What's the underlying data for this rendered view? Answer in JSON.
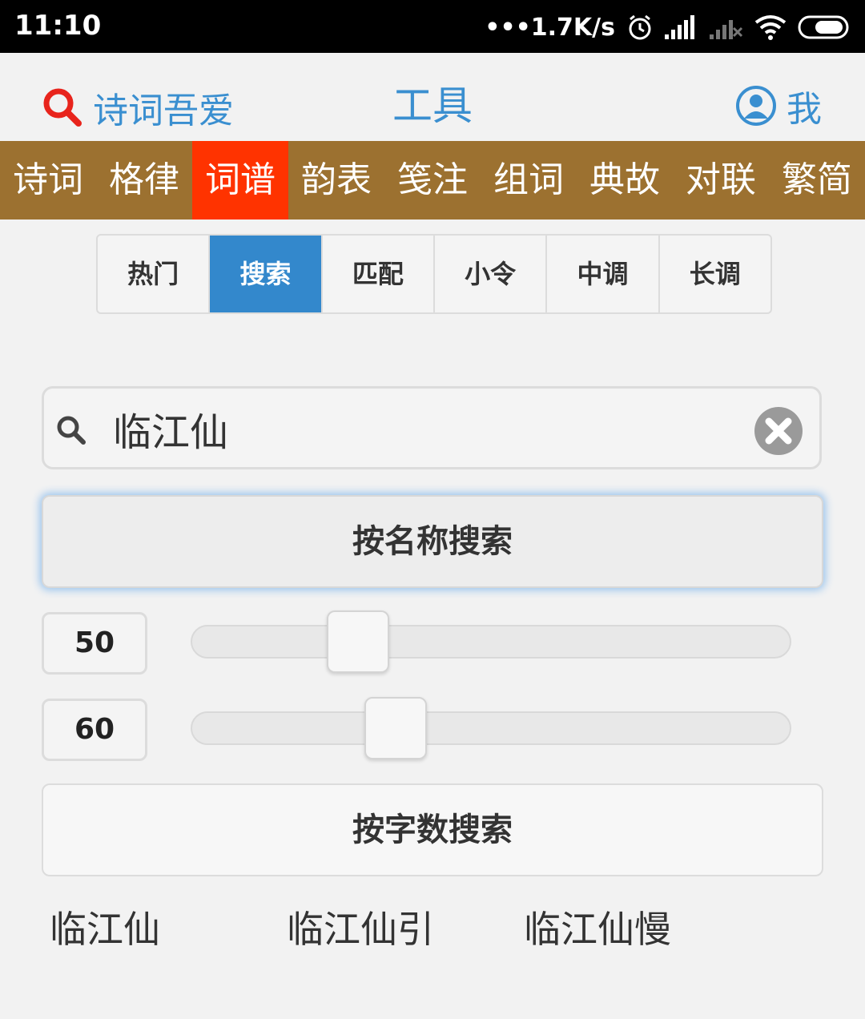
{
  "status_bar": {
    "time": "11:10",
    "network_speed": "•••1.7K/s",
    "icons": [
      "alarm-icon",
      "signal-icon",
      "signal-weak-icon",
      "wifi-icon",
      "battery-icon"
    ]
  },
  "header": {
    "brand": "诗词吾爱",
    "title": "工具",
    "me": "我"
  },
  "main_nav": {
    "items": [
      {
        "label": "诗词"
      },
      {
        "label": "格律"
      },
      {
        "label": "词谱"
      },
      {
        "label": "韵表"
      },
      {
        "label": "笺注"
      },
      {
        "label": "组词"
      },
      {
        "label": "典故"
      },
      {
        "label": "对联"
      },
      {
        "label": "繁简"
      }
    ],
    "active_index": 2
  },
  "sub_tabs": {
    "items": [
      {
        "label": "热门"
      },
      {
        "label": "搜索"
      },
      {
        "label": "匹配"
      },
      {
        "label": "小令"
      },
      {
        "label": "中调"
      },
      {
        "label": "长调"
      }
    ],
    "active_index": 1
  },
  "search": {
    "value": "临江仙",
    "placeholder": ""
  },
  "buttons": {
    "search_by_name": "按名称搜索",
    "search_by_count": "按字数搜索"
  },
  "sliders": [
    {
      "value": "50",
      "fraction": 0.25
    },
    {
      "value": "60",
      "fraction": 0.32
    }
  ],
  "results": [
    {
      "label": "临江仙"
    },
    {
      "label": "临江仙引"
    },
    {
      "label": "临江仙慢"
    }
  ],
  "colors": {
    "brand_blue": "#3a8fd0",
    "nav_brown": "#9c7130",
    "nav_active": "#ff3300",
    "tab_active": "#3388cc"
  }
}
